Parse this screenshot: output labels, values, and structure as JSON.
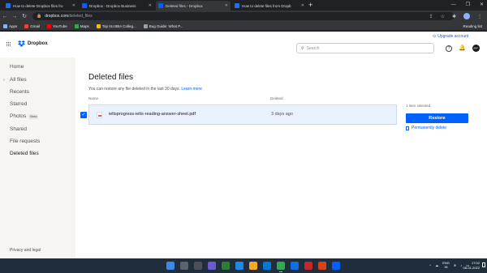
{
  "browser": {
    "tabs": [
      {
        "title": "How to delete Dropbox files fro",
        "fav": "#1a73e8",
        "active": false
      },
      {
        "title": "Dropbox - Dropbox Business",
        "fav": "#0061fe",
        "active": false
      },
      {
        "title": "Deleted files - Dropbox",
        "fav": "#0061fe",
        "active": true
      },
      {
        "title": "How to delete files from Dropb",
        "fav": "#1a73e8",
        "active": false
      }
    ],
    "new_tab": "+",
    "url_host": "dropbox.com",
    "url_path": "/deleted_files",
    "bookmarks": [
      {
        "label": "Apps",
        "color": "#8ab4f8"
      },
      {
        "label": "Gmail",
        "color": "#ea4335"
      },
      {
        "label": "YouTube",
        "color": "#ff0000"
      },
      {
        "label": "Maps",
        "color": "#34a853"
      },
      {
        "label": "Top IIU BBA Colleg...",
        "color": "#fbbc04"
      },
      {
        "label": "Bug Guide: What P...",
        "color": "#9aa0a6"
      }
    ],
    "reading_list": "Reading list"
  },
  "app": {
    "logo_text": "Dropbox",
    "brand_color": "#0061fe",
    "upgrade_label": "Upgrade account",
    "search_placeholder": "Search",
    "avatar_initials": "PP"
  },
  "sidebar": {
    "items": [
      {
        "label": "Home",
        "active": false
      },
      {
        "label": "All files",
        "active": false,
        "caret": true
      },
      {
        "label": "Recents",
        "active": false
      },
      {
        "label": "Starred",
        "active": false
      },
      {
        "label": "Photos",
        "active": false,
        "badge": "Beta"
      },
      {
        "label": "Shared",
        "active": false
      },
      {
        "label": "File requests",
        "active": false
      },
      {
        "label": "Deleted files",
        "active": true
      }
    ],
    "privacy": "Privacy and legal"
  },
  "main": {
    "title": "Deleted files",
    "subtitle": "You can restore any file deleted in the last 30 days.",
    "learn_more": "Learn more",
    "col_name": "Name",
    "col_deleted": "Deleted",
    "file": {
      "name": "ieltsprogress-ielts-reading-answer-sheet.pdf",
      "deleted": "3 days ago"
    },
    "selected_count": "1 item selected",
    "restore_label": "Restore",
    "perm_delete_label": "Permanently delete"
  },
  "taskbar": {
    "lang_top": "ENG",
    "lang_bottom": "IN",
    "time": "17:02",
    "date": "08-01-2022"
  }
}
